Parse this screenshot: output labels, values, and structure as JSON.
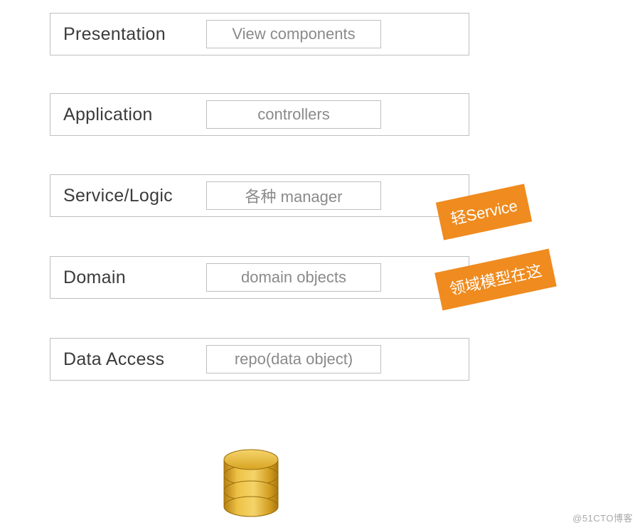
{
  "layers": [
    {
      "title": "Presentation",
      "inner": "View components"
    },
    {
      "title": "Application",
      "inner": "controllers"
    },
    {
      "title": "Service/Logic",
      "inner": "各种 manager"
    },
    {
      "title": "Domain",
      "inner": "domain objects"
    },
    {
      "title": "Data Access",
      "inner": "repo(data object)"
    }
  ],
  "tags": {
    "service": "轻Service",
    "domain": "领域模型在这"
  },
  "watermark": "@51CTO博客"
}
